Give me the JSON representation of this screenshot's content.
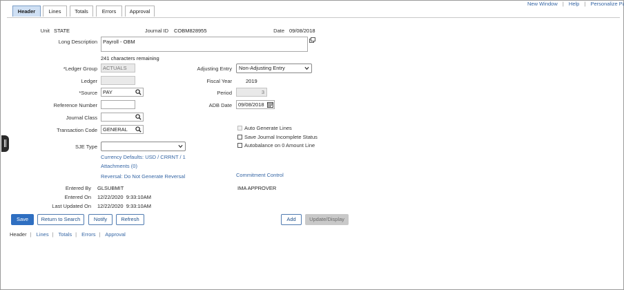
{
  "tabs": [
    {
      "label": "Header",
      "active": true
    },
    {
      "label": "Lines",
      "active": false
    },
    {
      "label": "Totals",
      "active": false
    },
    {
      "label": "Errors",
      "active": false
    },
    {
      "label": "Approval",
      "active": false
    }
  ],
  "top_links": {
    "new_window": "New Window",
    "separator1": "|",
    "help": "Help",
    "separator2": "|",
    "personalize": "Personalize Page"
  },
  "header": {
    "unit_label": "Unit",
    "unit_value": "STATE",
    "journal_id_label": "Journal ID",
    "journal_id_value": "COBM828955",
    "date_label": "Date",
    "date_value": "09/08/2018"
  },
  "long_description": {
    "label": "Long Description",
    "value": "Payroll - OBM",
    "remaining": "241 characters remaining"
  },
  "fields": {
    "ledger_group_label": "*Ledger Group",
    "ledger_group_value": "ACTUALS",
    "ledger_label": "Ledger",
    "ledger_value": "",
    "source_label": "*Source",
    "source_value": "PAY",
    "reference_label": "Reference Number",
    "reference_value": "",
    "journal_class_label": "Journal Class",
    "journal_class_value": "",
    "transaction_code_label": "Transaction Code",
    "transaction_code_value": "GENERAL",
    "sje_type_label": "SJE Type",
    "sje_type_value": "",
    "adjusting_entry_label": "Adjusting Entry",
    "adjusting_entry_value": "Non-Adjusting Entry",
    "fiscal_year_label": "Fiscal Year",
    "fiscal_year_value": "2019",
    "period_label": "Period",
    "period_value": "3",
    "adb_date_label": "ADB Date",
    "adb_date_value": "09/08/2018"
  },
  "checkboxes": [
    {
      "label": "Auto Generate Lines",
      "checked": false,
      "disabled": true
    },
    {
      "label": "Save Journal Incomplete Status",
      "checked": false,
      "disabled": false
    },
    {
      "label": "Autobalance on 0 Amount Line",
      "checked": false,
      "disabled": false
    }
  ],
  "links": {
    "currency_defaults": "Currency Defaults: USD / CRRNT / 1",
    "attachments": "Attachments (0)",
    "reversal": "Reversal: Do Not Generate Reversal",
    "commitment_control": "Commitment Control"
  },
  "audit": {
    "entered_by_label": "Entered By",
    "entered_by_value": "GLSUBMIT",
    "approver": "IMA APPROVER",
    "entered_on_label": "Entered On",
    "entered_on_value": "12/22/2020  9:33:10AM",
    "last_updated_label": "Last Updated On",
    "last_updated_value": "12/22/2020  9:33:10AM"
  },
  "buttons": {
    "save": "Save",
    "return": "Return to Search",
    "notify": "Notify",
    "refresh": "Refresh",
    "add": "Add",
    "update": "Update/Display"
  },
  "bottom_nav": [
    "Header",
    "Lines",
    "Totals",
    "Errors",
    "Approval"
  ],
  "colors": {
    "accent": "#2f6fc1",
    "link": "#3465a4",
    "active_tab": "#cfe0f4"
  }
}
